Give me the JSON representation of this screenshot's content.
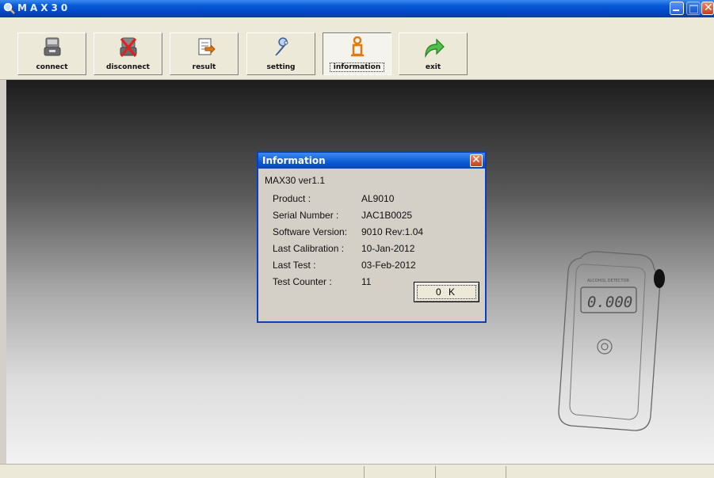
{
  "window": {
    "title": "MAX30"
  },
  "toolbar": {
    "items": [
      {
        "label": "connect",
        "icon": "connect-icon"
      },
      {
        "label": "disconnect",
        "icon": "disconnect-icon"
      },
      {
        "label": "result",
        "icon": "result-icon"
      },
      {
        "label": "setting",
        "icon": "wrench-icon"
      },
      {
        "label": "information",
        "icon": "information-icon",
        "active": true
      },
      {
        "label": "exit",
        "icon": "exit-arrow-icon"
      }
    ]
  },
  "dialog": {
    "title": "Information",
    "heading": "MAX30 ver1.1",
    "rows": [
      {
        "key": "Product :",
        "value": "AL9010"
      },
      {
        "key": "Serial Number :",
        "value": "JAC1B0025"
      },
      {
        "key": "Software Version:",
        "value": "9010 Rev:1.04"
      },
      {
        "key": "Last Calibration :",
        "value": "10-Jan-2012"
      },
      {
        "key": "Last Test :",
        "value": "03-Feb-2012"
      },
      {
        "key": "Test Counter :",
        "value": "11"
      }
    ],
    "ok_label": "0 K"
  },
  "device": {
    "reading": "0.000",
    "brand_text": "ALCOHOL DETECTOR"
  },
  "colors": {
    "titlebar": "#0a5bd6",
    "dialog_border": "#0a3fbd",
    "close": "#c3431f",
    "info_icon": "#e07a10",
    "exit_icon": "#3aa23a"
  }
}
